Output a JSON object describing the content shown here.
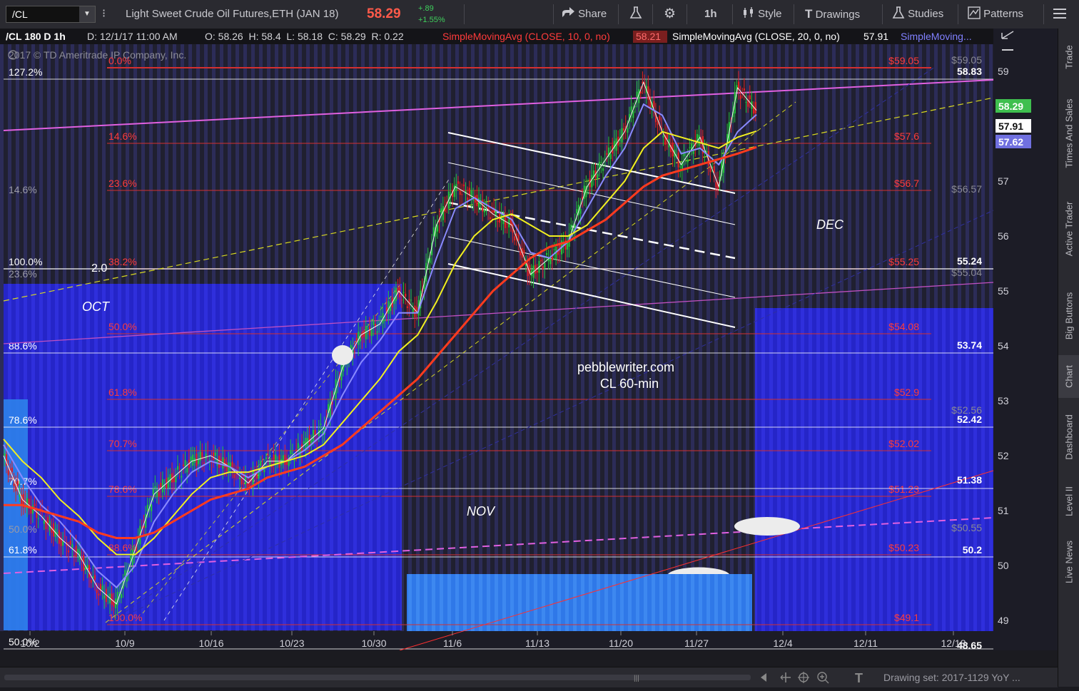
{
  "toolbar": {
    "symbol": "/CL",
    "description": "Light Sweet Crude Oil Futures,ETH (JAN 18)",
    "last_price": "58.29",
    "change": "+.89",
    "change_pct": "+1.55%",
    "share": "Share",
    "interval": "1h",
    "style": "Style",
    "drawings": "Drawings",
    "studies": "Studies",
    "patterns": "Patterns"
  },
  "header": {
    "title": "/CL 180 D 1h",
    "date": "D: 12/1/17 11:00 AM",
    "ohlc": "O: 58.26  H: 58.4  L: 58.18  C: 58.29  R: 0.22",
    "sma10_label": "SimpleMovingAvg (CLOSE, 10, 0, no)",
    "sma10_value": "58.21",
    "sma20_label": "SimpleMovingAvg (CLOSE, 20, 0, no)",
    "sma20_value": "57.91",
    "sma3_label": "SimpleMoving...",
    "copyright": "2017 © TD Ameritrade IP Company, Inc."
  },
  "sidebar": {
    "items": [
      {
        "label": "Trade"
      },
      {
        "label": "Times And Sales"
      },
      {
        "label": "Active Trader"
      },
      {
        "label": "Big Buttons"
      },
      {
        "label": "Chart"
      },
      {
        "label": "Dashboard"
      },
      {
        "label": "Level II"
      },
      {
        "label": "Live News"
      }
    ]
  },
  "axis": {
    "y_ticks": [
      "59",
      "57",
      "56",
      "55",
      "54",
      "53",
      "52",
      "51",
      "50",
      "49"
    ],
    "x_ticks": [
      "10/2",
      "10/9",
      "10/16",
      "10/23",
      "10/30",
      "11/6",
      "11/13",
      "11/20",
      "11/27",
      "12/4",
      "12/11",
      "12/18"
    ],
    "price_badges": [
      {
        "text": "58.83",
        "color": "#ffffff"
      },
      {
        "text": "58.29",
        "color": "#3fbf4f"
      },
      {
        "text": "57.91",
        "color": "#ffffff"
      },
      {
        "text": "57.62",
        "color": "#7070e0"
      },
      {
        "text": "55.24",
        "color": "#ffffff"
      },
      {
        "text": "53.74",
        "color": "#ffffff"
      },
      {
        "text": "52.42",
        "color": "#ffffff"
      },
      {
        "text": "51.38",
        "color": "#ffffff"
      },
      {
        "text": "50.2",
        "color": "#ffffff"
      },
      {
        "text": "48.65",
        "color": "#ffffff"
      }
    ]
  },
  "fib_red": {
    "pct": [
      "0.0%",
      "14.6%",
      "23.6%",
      "38.2%",
      "50.0%",
      "61.8%",
      "70.7%",
      "78.6%",
      "88.6%",
      "100.0%"
    ],
    "prices": [
      "$59.05",
      "$57.6",
      "$56.7",
      "$55.25",
      "$54.08",
      "$52.9",
      "$52.02",
      "$51.23",
      "$50.23",
      "$49.1"
    ]
  },
  "fib_white": {
    "pct": [
      "127.2%",
      "100.0%",
      "88.6%",
      "78.6%",
      "70.7%",
      "61.8%",
      "50.0%"
    ]
  },
  "fib_grey": {
    "pct": [
      "14.6%",
      "23.6%",
      "50.0%"
    ],
    "prices": [
      "$59.05",
      "$56.57",
      "$55.04",
      "$52.56",
      "$50.55"
    ]
  },
  "annotations": {
    "oct": "OCT",
    "nov": "NOV",
    "dec": "DEC",
    "site": "pebblewriter.com",
    "sub": "CL 60-min",
    "wave": "2.0"
  },
  "bottom": {
    "drawing_set": "Drawing set: 2017-1129 YoY ..."
  },
  "chart_data": {
    "type": "line",
    "series": [
      {
        "name": "/CL",
        "values": [
          52.0,
          51.2,
          50.9,
          50.5,
          50.2,
          49.6,
          49.3,
          50.3,
          51.3,
          51.6,
          51.9,
          52.0,
          51.8,
          51.5,
          51.9,
          51.9,
          52.2,
          52.5,
          53.6,
          54.2,
          54.4,
          55.0,
          54.6,
          56.2,
          56.9,
          56.7,
          56.4,
          56.2,
          55.3,
          55.6,
          55.9,
          56.9,
          57.4,
          57.9,
          58.8,
          57.9,
          57.3,
          57.8,
          56.9,
          58.7,
          58.29
        ]
      },
      {
        "name": "SimpleMovingAvg (CLOSE, 10, 0, no)",
        "values": [
          52.2,
          51.6,
          51.1,
          50.8,
          50.4,
          49.9,
          49.6,
          50.0,
          50.8,
          51.3,
          51.7,
          51.9,
          51.8,
          51.6,
          51.8,
          51.9,
          52.1,
          52.4,
          53.1,
          53.7,
          54.1,
          54.6,
          54.6,
          55.6,
          56.5,
          56.7,
          56.5,
          56.3,
          55.7,
          55.6,
          55.9,
          56.5,
          57.1,
          57.6,
          58.4,
          58.2,
          57.5,
          57.6,
          57.3,
          57.9,
          58.21
        ]
      },
      {
        "name": "SimpleMovingAvg (CLOSE, 20, 0, no)",
        "values": [
          52.3,
          51.9,
          51.6,
          51.2,
          50.9,
          50.5,
          50.2,
          50.2,
          50.5,
          50.9,
          51.3,
          51.6,
          51.7,
          51.7,
          51.8,
          51.9,
          52.0,
          52.2,
          52.6,
          53.0,
          53.4,
          53.9,
          54.2,
          54.8,
          55.5,
          56.0,
          56.3,
          56.4,
          56.2,
          56.0,
          56.0,
          56.2,
          56.6,
          57.0,
          57.6,
          57.9,
          57.8,
          57.7,
          57.6,
          57.8,
          57.91
        ]
      },
      {
        "name": "SimpleMoving...",
        "values": [
          51.1,
          51.1,
          51.0,
          50.9,
          50.8,
          50.6,
          50.5,
          50.5,
          50.6,
          50.8,
          51.0,
          51.2,
          51.3,
          51.4,
          51.6,
          51.7,
          51.8,
          52.0,
          52.2,
          52.5,
          52.8,
          53.1,
          53.4,
          53.8,
          54.2,
          54.6,
          55.0,
          55.3,
          55.6,
          55.8,
          55.9,
          56.1,
          56.3,
          56.6,
          56.9,
          57.1,
          57.2,
          57.3,
          57.4,
          57.5,
          57.62
        ]
      }
    ],
    "ylim": [
      48.6,
      59.3
    ]
  }
}
